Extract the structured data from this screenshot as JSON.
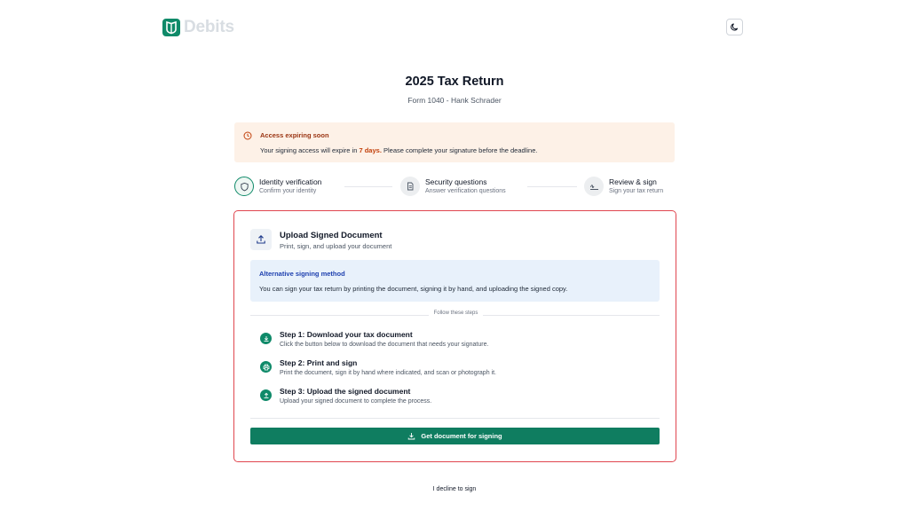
{
  "brand": {
    "name": "Debits",
    "icon": "shield-book-logo-icon",
    "color": "#0f8a69"
  },
  "theme_toggle": {
    "icon": "moon-icon"
  },
  "header": {
    "title": "2025 Tax Return",
    "subtitle": "Form 1040 - Hank Schrader"
  },
  "alert": {
    "icon": "clock-icon",
    "title": "Access expiring soon",
    "body_prefix": "Your signing access will expire in",
    "body_highlight": "7 days.",
    "body_suffix": "Please complete your signature before the deadline.",
    "bg_color": "#fdf1e7",
    "title_color": "#9a3412"
  },
  "stepper": [
    {
      "title": "Identity verification",
      "subtitle": "Confirm your identity",
      "icon": "shield-icon",
      "state": "active"
    },
    {
      "title": "Security questions",
      "subtitle": "Answer verification questions",
      "icon": "document-icon",
      "state": "pending"
    },
    {
      "title": "Review & sign",
      "subtitle": "Sign your tax return",
      "icon": "signature-icon",
      "state": "pending"
    }
  ],
  "card": {
    "icon": "upload-icon",
    "title": "Upload Signed Document",
    "subtitle": "Print, sign, and upload your document",
    "info": {
      "title": "Alternative signing method",
      "body": "You can sign your tax return by printing the document, signing it by hand, and uploading the signed copy."
    },
    "divider_label": "Follow these steps",
    "steps": [
      {
        "icon": "download-icon",
        "title": "Step 1: Download your tax document",
        "description": "Click the button below to download the document that needs your signature."
      },
      {
        "icon": "printer-icon",
        "title": "Step 2: Print and sign",
        "description": "Print the document, sign it by hand where indicated, and scan or photograph it."
      },
      {
        "icon": "upload-icon",
        "title": "Step 3: Upload the signed document",
        "description": "Upload your signed document to complete the process."
      }
    ],
    "button": {
      "label": "Get document for signing",
      "icon": "download-icon",
      "color": "#0f7d60"
    },
    "border_color": "#e0464f"
  },
  "decline_label": "I decline to sign"
}
